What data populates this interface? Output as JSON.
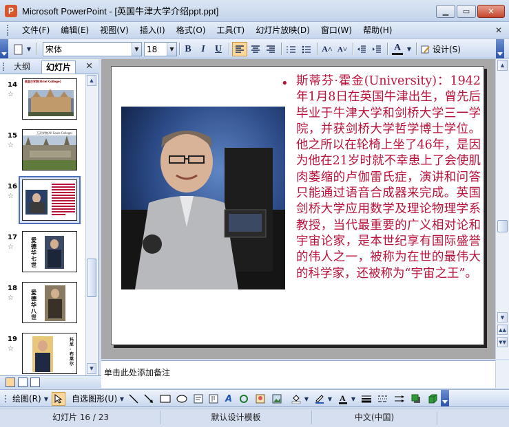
{
  "window": {
    "title": "Microsoft PowerPoint - [英国牛津大学介绍ppt.ppt]",
    "app_icon_letter": "P",
    "min_glyph": "▁",
    "max_glyph": "▭",
    "close_glyph": "✕"
  },
  "menu": {
    "items": [
      "文件(F)",
      "编辑(E)",
      "视图(V)",
      "插入(I)",
      "格式(O)",
      "工具(T)",
      "幻灯片放映(D)",
      "窗口(W)",
      "帮助(H)"
    ],
    "close_doc_glyph": "✕"
  },
  "toolbar": {
    "font_name": "宋体",
    "font_size": "18",
    "bold": "B",
    "italic": "I",
    "underline": "U",
    "increase_font": "A˄",
    "decrease_font": "A˅",
    "font_color_glyph": "A",
    "design_label": "设计(S)",
    "active_align": "left"
  },
  "left_pane": {
    "tabs": [
      "大纲",
      "幻灯片"
    ],
    "active_tab": "幻灯片",
    "close_glyph": "✕",
    "thumbnails": [
      {
        "number": "14",
        "heading": "奥里尔学院(Oriel College)"
      },
      {
        "number": "15",
        "heading": "万灵学院(All Souls College)"
      },
      {
        "number": "16",
        "heading": ""
      },
      {
        "number": "17",
        "heading": "爱德华七世"
      },
      {
        "number": "18",
        "heading": "爱德华八世"
      },
      {
        "number": "19",
        "heading": "托尼·布莱尔"
      }
    ],
    "selected_slide": "16",
    "star_glyph": "☆"
  },
  "slide": {
    "bullet": "•",
    "text": "斯蒂芬·霍金(University)：1942年1月8日在英国牛津出生，曾先后毕业于牛津大学和剑桥大学三一学院，并获剑桥大学哲学博士学位。他之所以在轮椅上坐了46年，是因为他在21岁时就不幸患上了会使肌肉萎缩的卢伽雷氏症，演讲和问答只能通过语音合成器来完成。英国剑桥大学应用数学及理论物理学系教授，当代最重要的广义相对论和宇宙论家，是本世纪享有国际盛誉的伟人之一，被称为在世的最伟大的科学家，还被称为“宇宙之王”。",
    "text_color": "#b8123a"
  },
  "notes": {
    "placeholder": "单击此处添加备注"
  },
  "drawing_toolbar": {
    "draw_label": "绘图(R)",
    "autoshape_label": "自选图形(U)"
  },
  "status": {
    "slide_info": "幻灯片 16 / 23",
    "template": "默认设计模板",
    "language": "中文(中国)"
  }
}
